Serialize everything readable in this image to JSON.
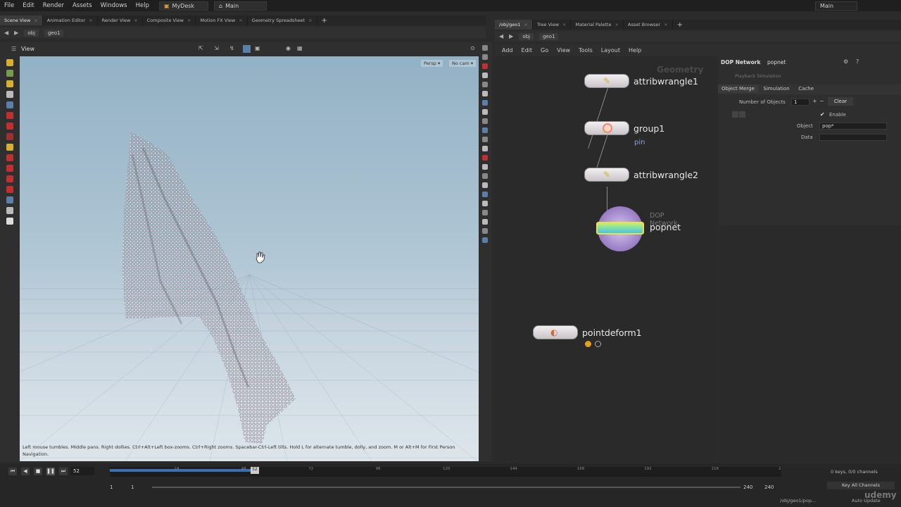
{
  "menubar": {
    "items": [
      "File",
      "Edit",
      "Render",
      "Assets",
      "Windows",
      "Help"
    ],
    "desktop": "MyDesk",
    "main": "Main",
    "right_main": "Main"
  },
  "left_tabs": [
    {
      "label": "Scene View",
      "active": true
    },
    {
      "label": "Animation Editor",
      "active": false
    },
    {
      "label": "Render View",
      "active": false
    },
    {
      "label": "Composite View",
      "active": false
    },
    {
      "label": "Motion FX View",
      "active": false
    },
    {
      "label": "Geometry Spreadsheet",
      "active": false
    }
  ],
  "right_tabs": [
    {
      "label": "/obj/geo1",
      "active": true
    },
    {
      "label": "Tree View",
      "active": false
    },
    {
      "label": "Material Palette",
      "active": false
    },
    {
      "label": "Asset Browser",
      "active": false
    }
  ],
  "left_path": [
    "obj",
    "geo1"
  ],
  "right_path": [
    "obj",
    "geo1"
  ],
  "viewport": {
    "title": "View",
    "persp": "Persp",
    "cam": "No cam",
    "hint": "Left mouse tumbles. Middle pans. Right dollies. Ctrl+Alt+Left box-zooms. Ctrl+Right zooms. Spacebar-Ctrl-Left tilts. Hold L for alternate tumble, dolly, and zoom.    M or Alt+M for First Person Navigation."
  },
  "network": {
    "menu": [
      "Add",
      "Edit",
      "Go",
      "View",
      "Tools",
      "Layout",
      "Help"
    ],
    "context_label": "Geometry",
    "nodes": {
      "wrangle1": "attribwrangle1",
      "group1": "group1",
      "group1_sub": "pin",
      "wrangle2": "attribwrangle2",
      "popnet_type": "DOP Network",
      "popnet": "popnet",
      "pointdeform": "pointdeform1"
    }
  },
  "params": {
    "node_type": "DOP Network",
    "node_name": "popnet",
    "playback": "Playback Simulation",
    "tabs": [
      "Object Merge",
      "Simulation",
      "Cache"
    ],
    "number_label": "Number of Objects",
    "number_value": "1",
    "clear": "Clear",
    "enable": "Enable",
    "object_label": "Object",
    "object_value": "pop*",
    "data_label": "Data"
  },
  "timeline": {
    "current_frame": "52",
    "start": "1",
    "start2": "1",
    "end": "240",
    "end2": "240",
    "ticks": [
      "24",
      "48",
      "72",
      "96",
      "120",
      "144",
      "168",
      "192",
      "216",
      "2"
    ],
    "keys": "0 keys, 0/0 channels",
    "key_all": "Key All Channels",
    "auto_update": "Auto Update",
    "path": "/obj/geo1/pop...",
    "progress": 0.216
  },
  "watermark": "udemy"
}
